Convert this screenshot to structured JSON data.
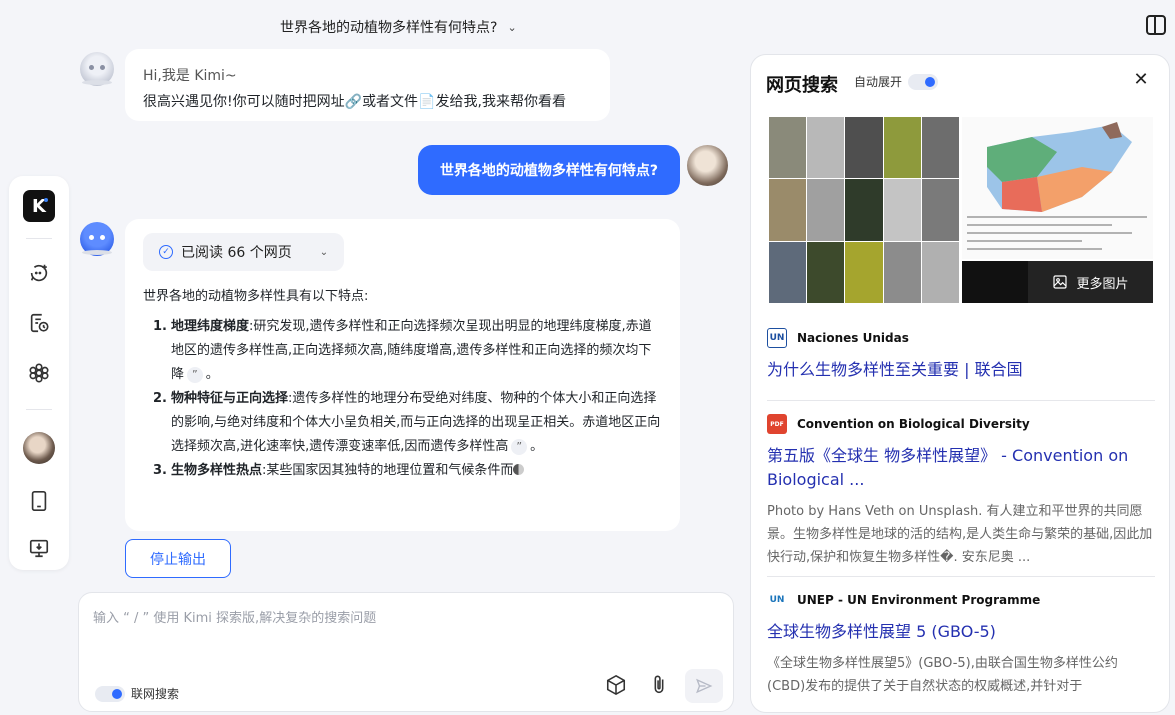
{
  "header": {
    "title": "世界各地的动植物多样性有何特点?",
    "chevron_icon": "chevron-down-icon"
  },
  "sidebar": {
    "logo": "K",
    "items": [
      {
        "name": "new-chat",
        "icon": "chat-plus-icon"
      },
      {
        "name": "history",
        "icon": "history-icon"
      },
      {
        "name": "explore",
        "icon": "flower-icon"
      },
      {
        "name": "profile",
        "icon": "avatar"
      },
      {
        "name": "phone",
        "icon": "phone-icon"
      },
      {
        "name": "desktop-download",
        "icon": "desktop-download-icon"
      }
    ]
  },
  "greeting": {
    "line1": "Hi,我是 Kimi~",
    "line2_a": "很高兴遇见你!你可以随时把网址",
    "line2_b": "或者文件",
    "line2_c": "发给我,我来帮你看看"
  },
  "user_message": "世界各地的动植物多样性有何特点?",
  "answer": {
    "read_pill": "已阅读 66 个网页",
    "intro": "世界各地的动植物多样性具有以下特点:",
    "items": [
      {
        "num": "1.",
        "title": "地理纬度梯度",
        "colon": ":",
        "text": "研究发现,遗传多样性和正向选择频次呈现出明显的地理纬度梯度,赤道地区的遗传多样性高,正向选择频次高,随纬度增高,遗传多样性和正向选择的频次均下降",
        "quote": "”",
        "end": "。"
      },
      {
        "num": "2.",
        "title": "物种特征与正向选择",
        "colon": ":",
        "text": "遗传多样性的地理分布受绝对纬度、物种的个体大小和正向选择的影响,与绝对纬度和个体大小呈负相关,而与正向选择的出现呈正相关。赤道地区正向选择频次高,进化速率快,遗传漂变速率低,因而遗传多样性高",
        "quote": "”",
        "end": "。"
      },
      {
        "num": "3.",
        "title": "生物多样性热点",
        "colon": ":",
        "text": "某些国家因其独特的地理位置和气候条件而"
      }
    ]
  },
  "stop_button": "停止输出",
  "input": {
    "placeholder": "输入 “ / ” 使用 Kimi 探索版,解决复杂的搜索问题",
    "web_search_label": "联网搜索",
    "web_search_on": true
  },
  "right_panel": {
    "title": "网页搜索",
    "auto_expand_label": "自动展开",
    "auto_expand_on": true,
    "more_images": "更多图片",
    "sources": [
      {
        "site": "Naciones Unidas",
        "logo": "UN",
        "logo_color": "#1d4fa0",
        "title": "为什么生物多样性至关重要 | 联合国",
        "desc": ""
      },
      {
        "site": "Convention on Biological Diversity",
        "logo": "PDF",
        "logo_color": "#e0442f",
        "title": "第五版《全球生 物多样性展望》 - Convention on Biological ...",
        "desc": "Photo by Hans Veth on Unsplash. 有人建立和平世界的共同愿景。生物多样性是地球的活的结构,是人类生命与繁荣的基础,因此加快行动,保护和恢复生物多样性�. 安东尼奥 ..."
      },
      {
        "site": "UNEP - UN Environment Programme",
        "logo": "UN",
        "logo_color": "#1b75bb",
        "title": "全球生物多样性展望 5 (GBO-5)",
        "desc": "《全球生物多样性展望5》(GBO-5),由联合国生物多样性公约(CBD)发布的提供了关于自然状态的权威概述,并针对于"
      }
    ]
  },
  "colors": {
    "accent": "#2f6bff",
    "link": "#2430b0"
  }
}
